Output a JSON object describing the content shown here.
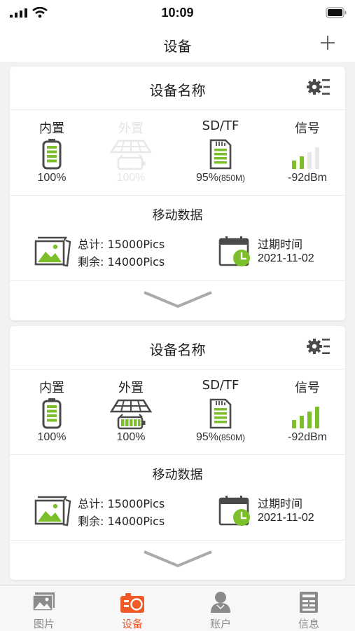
{
  "status_bar": {
    "time": "10:09"
  },
  "nav": {
    "title": "设备"
  },
  "colors": {
    "accent_green": "#7cbf2a",
    "accent_orange": "#f05a28",
    "icon_dark": "#4a4a4a",
    "tab_gray": "#8a8a8a"
  },
  "devices": [
    {
      "title": "设备名称",
      "stats": [
        {
          "label": "内置",
          "value": "100%",
          "icon": "internal-battery-icon"
        },
        {
          "label": "外置",
          "value": "100%",
          "icon": "solar-battery-icon",
          "state": "unavailable"
        },
        {
          "label": "SD/TF",
          "value": "95%",
          "sub": "(850M)",
          "icon": "sd-card-icon"
        },
        {
          "label": "信号",
          "value": "-92dBm",
          "icon": "signal-strength-icon",
          "level": 2
        }
      ],
      "data": {
        "title": "移动数据",
        "total": "总计: 15000Pics",
        "remaining": "剩余: 14000Pics",
        "expiry_label": "过期时间",
        "expiry_date": "2021-11-02"
      }
    },
    {
      "title": "设备名称",
      "stats": [
        {
          "label": "内置",
          "value": "100%",
          "icon": "internal-battery-icon"
        },
        {
          "label": "外置",
          "value": "100%",
          "icon": "solar-battery-icon",
          "state": "available"
        },
        {
          "label": "SD/TF",
          "value": "95%",
          "sub": "(850M)",
          "icon": "sd-card-icon"
        },
        {
          "label": "信号",
          "value": "-92dBm",
          "icon": "signal-strength-icon",
          "level": 4
        }
      ],
      "data": {
        "title": "移动数据",
        "total": "总计: 15000Pics",
        "remaining": "剩余: 14000Pics",
        "expiry_label": "过期时间",
        "expiry_date": "2021-11-02"
      }
    }
  ],
  "tabs": [
    {
      "label": "图片",
      "icon": "gallery-icon"
    },
    {
      "label": "设备",
      "icon": "device-icon",
      "active": true
    },
    {
      "label": "账户",
      "icon": "account-icon"
    },
    {
      "label": "信息",
      "icon": "info-icon"
    }
  ]
}
